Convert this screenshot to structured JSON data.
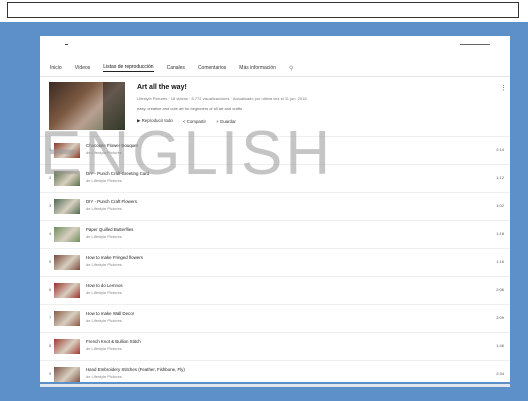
{
  "tabs": [
    {
      "label": "Inicio"
    },
    {
      "label": "Vídeos"
    },
    {
      "label": "Listas de reproducción",
      "active": true
    },
    {
      "label": "Canales"
    },
    {
      "label": "Comentarios"
    },
    {
      "label": "Más información"
    }
  ],
  "playlist": {
    "title": "Art all the way!",
    "meta": "Lifestyle Pictures · 18 videos · 5.772 visualizaciones · Actualizado por última vez el 11 jun. 2018",
    "description": "easy, creative and cute art for beginners of all art and crafts",
    "actions": {
      "play_all": "Reproducir todo",
      "share": "Compartir",
      "save": "Guardar"
    }
  },
  "videos": [
    {
      "index": "1",
      "title": "Chocolate Flower Bouquet",
      "author": "de Lifestyle Pictures",
      "duration": "2:14",
      "thumb_color": "#8a3a2a"
    },
    {
      "index": "2",
      "title": "DIY - Punch Craft Greeting Card",
      "author": "de Lifestyle Pictures",
      "duration": "1:12",
      "thumb_color": "#5a7048"
    },
    {
      "index": "3",
      "title": "DIY - Punch Craft Flowers",
      "author": "de Lifestyle Pictures",
      "duration": "1:02",
      "thumb_color": "#4f6b52"
    },
    {
      "index": "4",
      "title": "Paper Quilled Butterflies",
      "author": "de Lifestyle Pictures",
      "duration": "1:18",
      "thumb_color": "#6f8f5e"
    },
    {
      "index": "5",
      "title": "How to make Fringed flowers",
      "author": "de Lifestyle Pictures",
      "duration": "1:16",
      "thumb_color": "#7a4a3a"
    },
    {
      "index": "6",
      "title": "How to do Lemnos",
      "author": "de Lifestyle Pictures",
      "duration": "2:06",
      "thumb_color": "#9a3028"
    },
    {
      "index": "7",
      "title": "How to make Wall Decor",
      "author": "de Lifestyle Pictures",
      "duration": "2:09",
      "thumb_color": "#8b5b45"
    },
    {
      "index": "8",
      "title": "French Knot & Bullion Stitch",
      "author": "de Lifestyle Pictures",
      "duration": "1:46",
      "thumb_color": "#a23a32"
    },
    {
      "index": "9",
      "title": "Hand Embroidery Stitches (Feather, Fishbone, Fly)",
      "author": "de Lifestyle Pictures",
      "duration": "2:34",
      "thumb_color": "#7e5646"
    }
  ],
  "watermark": "ENGLISH",
  "colors": {
    "frame_blue": "#5d90c8",
    "watermark": "#969696"
  }
}
